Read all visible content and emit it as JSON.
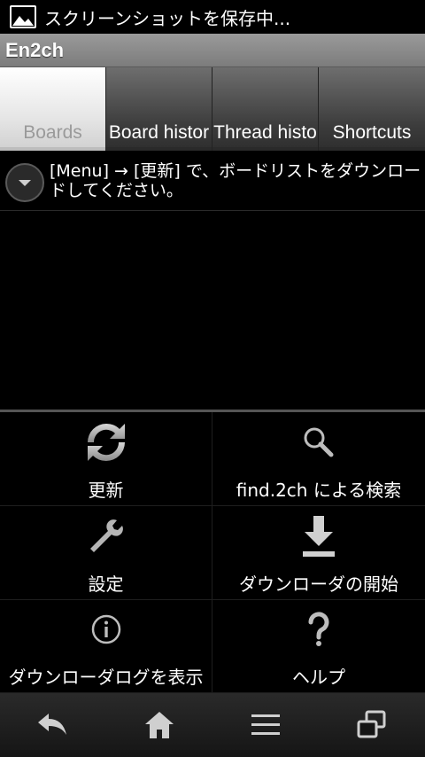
{
  "status_bar": {
    "text": "スクリーンショットを保存中..."
  },
  "app": {
    "title": "En2ch"
  },
  "tabs": [
    {
      "label": "Boards",
      "active": true
    },
    {
      "label": "Board histor",
      "active": false
    },
    {
      "label": "Thread histo",
      "active": false
    },
    {
      "label": "Shortcuts",
      "active": false
    }
  ],
  "info": {
    "message": "[Menu] → [更新] で、ボードリストをダウンロードしてください。"
  },
  "menu": {
    "items": [
      {
        "label": "更新",
        "icon": "refresh-icon"
      },
      {
        "label": "find.2ch による検索",
        "icon": "search-icon"
      },
      {
        "label": "設定",
        "icon": "wrench-icon"
      },
      {
        "label": "ダウンローダの開始",
        "icon": "download-icon"
      },
      {
        "label": "ダウンローダログを表示",
        "icon": "info-icon"
      },
      {
        "label": "ヘルプ",
        "icon": "question-icon"
      }
    ]
  },
  "nav": {
    "buttons": [
      "back-icon",
      "home-icon",
      "menu-icon",
      "recent-apps-icon"
    ]
  },
  "colors": {
    "title_bar": "#8a8a8a",
    "active_tab": "#f2f2f2",
    "background": "#000000"
  }
}
